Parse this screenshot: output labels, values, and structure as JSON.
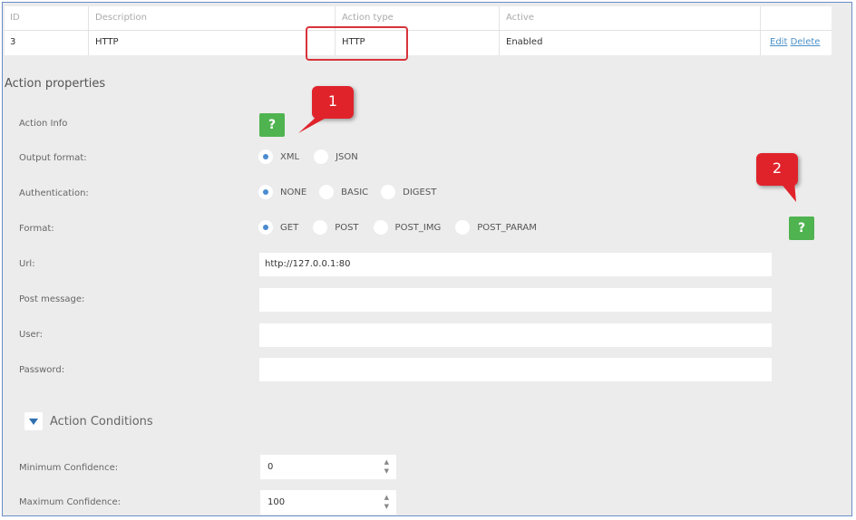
{
  "table": {
    "headers": {
      "id": "ID",
      "description": "Description",
      "action_type": "Action type",
      "active": "Active"
    },
    "row": {
      "id": "3",
      "description": "HTTP",
      "action_type": "HTTP",
      "active": "Enabled",
      "edit": "Edit",
      "delete": "Delete"
    }
  },
  "section_title": "Action properties",
  "labels": {
    "action_info": "Action Info",
    "output_format": "Output format:",
    "authentication": "Authentication:",
    "format": "Format:",
    "url": "Url:",
    "post_message": "Post message:",
    "user": "User:",
    "password": "Password:",
    "min_conf": "Minimum Confidence:",
    "max_conf": "Maximum Confidence:"
  },
  "help_label": "?",
  "output_format": {
    "options": [
      "XML",
      "JSON"
    ],
    "selected": "XML"
  },
  "authentication": {
    "options": [
      "NONE",
      "BASIC",
      "DIGEST"
    ],
    "selected": "NONE"
  },
  "format": {
    "options": [
      "GET",
      "POST",
      "POST_IMG",
      "POST_PARAM"
    ],
    "selected": "GET"
  },
  "fields": {
    "url": "http://127.0.0.1:80",
    "post_message": "",
    "user": "",
    "password": ""
  },
  "conditions": {
    "title": "Action Conditions",
    "min_confidence": "0",
    "max_confidence": "100"
  },
  "callouts": {
    "one": "1",
    "two": "2"
  },
  "colors": {
    "accent_blue": "#4a8cd0",
    "help_green": "#4fb34f",
    "callout_red": "#e0232b",
    "link_blue": "#4a90c9"
  }
}
